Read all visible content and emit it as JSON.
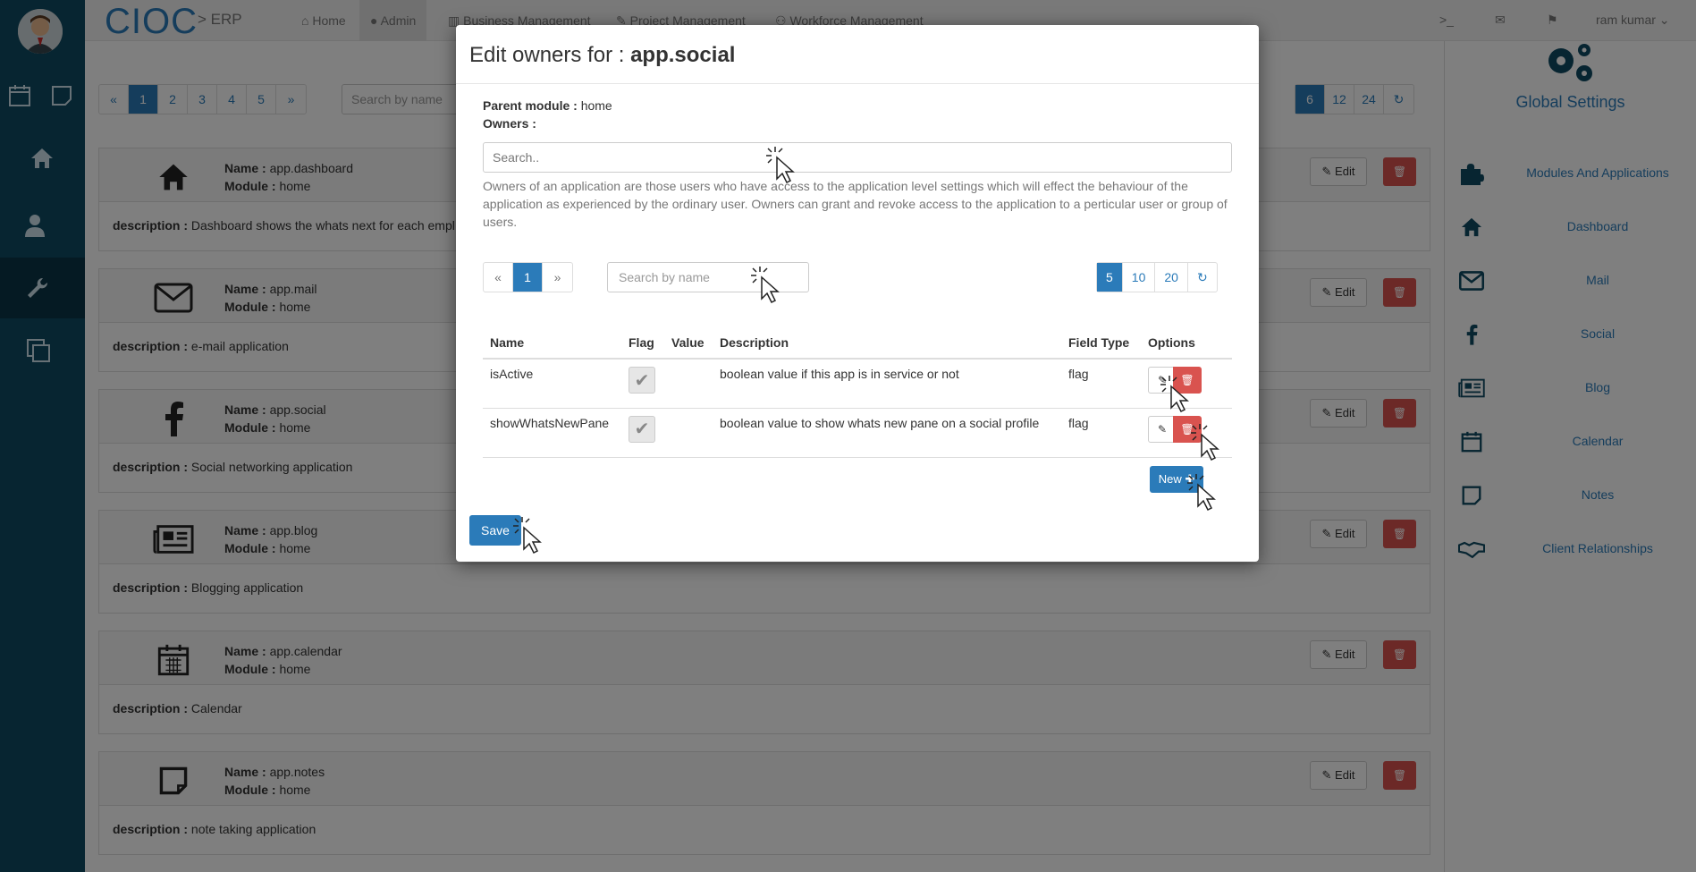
{
  "brand": {
    "name": "CIOC",
    "sub": "> ERP"
  },
  "nav": {
    "items": [
      {
        "icon": "home-icon",
        "label": "Home"
      },
      {
        "icon": "user-icon",
        "label": "Admin"
      },
      {
        "icon": "bar-chart-icon",
        "label": "Business Management"
      },
      {
        "icon": "wrench-icon",
        "label": "Project Management"
      },
      {
        "icon": "users-icon",
        "label": "Workforce Management"
      }
    ],
    "terminal": ">_",
    "user": "ram kumar"
  },
  "list": {
    "pages": [
      "«",
      "1",
      "2",
      "3",
      "4",
      "5",
      "»"
    ],
    "search_placeholder": "Search by name",
    "sizes": [
      "6",
      "12",
      "24"
    ],
    "edit_label": "Edit",
    "apps": [
      {
        "icon": "home-icon",
        "name_label": "Name :",
        "name": "app.dashboard",
        "module_label": "Module :",
        "module": "home",
        "desc_label": "description :",
        "desc": "Dashboard shows the whats next for each empl"
      },
      {
        "icon": "envelope-icon",
        "name_label": "Name :",
        "name": "app.mail",
        "module_label": "Module :",
        "module": "home",
        "desc_label": "description :",
        "desc": "e-mail application"
      },
      {
        "icon": "facebook-icon",
        "name_label": "Name :",
        "name": "app.social",
        "module_label": "Module :",
        "module": "home",
        "desc_label": "description :",
        "desc": "Social networking application"
      },
      {
        "icon": "newspaper-icon",
        "name_label": "Name :",
        "name": "app.blog",
        "module_label": "Module :",
        "module": "home",
        "desc_label": "description :",
        "desc": "Blogging application"
      },
      {
        "icon": "calendar-icon",
        "name_label": "Name :",
        "name": "app.calendar",
        "module_label": "Module :",
        "module": "home",
        "desc_label": "description :",
        "desc": "Calendar"
      },
      {
        "icon": "note-icon",
        "name_label": "Name :",
        "name": "app.notes",
        "module_label": "Module :",
        "module": "home",
        "desc_label": "description :",
        "desc": "note taking application"
      }
    ]
  },
  "settings": {
    "title": "Global Settings",
    "items": [
      {
        "icon": "puzzle-icon",
        "label": "Modules And Applications"
      },
      {
        "icon": "home-icon",
        "label": "Dashboard"
      },
      {
        "icon": "envelope-icon",
        "label": "Mail"
      },
      {
        "icon": "facebook-icon",
        "label": "Social"
      },
      {
        "icon": "newspaper-icon",
        "label": "Blog"
      },
      {
        "icon": "calendar-icon",
        "label": "Calendar"
      },
      {
        "icon": "note-icon",
        "label": "Notes"
      },
      {
        "icon": "handshake-icon",
        "label": "Client Relationships"
      }
    ]
  },
  "modal": {
    "title_prefix": "Edit owners for :",
    "title_app": "app.social",
    "parent_label": "Parent module :",
    "parent_value": "home",
    "owners_label": "Owners :",
    "owners_placeholder": "Search..",
    "help": "Owners of an application are those users who have access to the application level settings which will effect the behaviour of the application as experienced by the ordinary user. Owners can grant and revoke access to the application to a perticular user or group of users.",
    "pager": [
      "«",
      "1",
      "»"
    ],
    "name_search_placeholder": "Search by name",
    "sizes": [
      "5",
      "10",
      "20"
    ],
    "columns": [
      "Name",
      "Flag",
      "Value",
      "Description",
      "Field Type",
      "Options"
    ],
    "rows": [
      {
        "name": "isActive",
        "flag": true,
        "value": "",
        "description": "boolean value if this app is in service or not",
        "field_type": "flag"
      },
      {
        "name": "showWhatsNewPane",
        "flag": true,
        "value": "",
        "description": "boolean value to show whats new pane on a social profile",
        "field_type": "flag"
      }
    ],
    "new_label": "New",
    "save_label": "Save"
  },
  "colors": {
    "sidebar": "#0f4a63",
    "primary": "#2b7bb9",
    "danger": "#d9534f"
  }
}
